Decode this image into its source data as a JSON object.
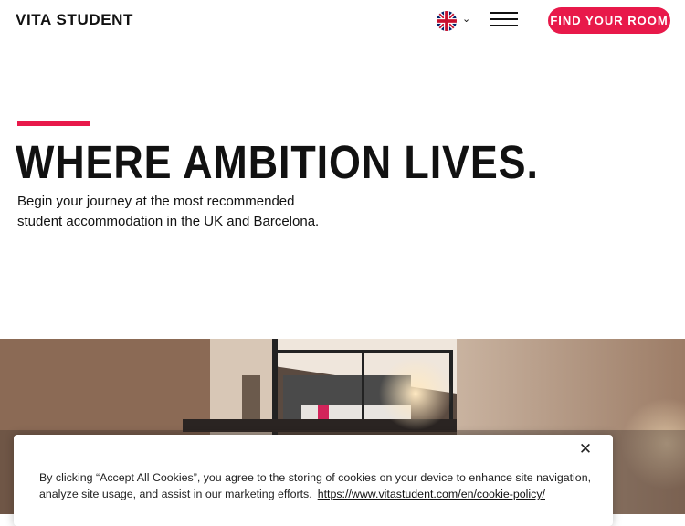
{
  "header": {
    "logo": "VITA STUDENT",
    "language_icon": "uk-flag-icon",
    "chevron_glyph": "⌄",
    "menu_icon": "hamburger-icon",
    "cta_label": "FIND YOUR ROOM"
  },
  "hero": {
    "title": "WHERE AMBITION LIVES.",
    "subtitle_line1": "Begin your journey at the most recommended",
    "subtitle_line2": "student accommodation in the UK and Barcelona."
  },
  "cookie_banner": {
    "close_glyph": "✕",
    "text": "By clicking “Accept All Cookies”, you agree to the storing of cookies on your device to enhance site navigation, analyze site usage, and assist in our marketing efforts.",
    "link_text": "https://www.vitastudent.com/en/cookie-policy/"
  },
  "colors": {
    "accent": "#e8194a",
    "text": "#111111",
    "background": "#ffffff"
  }
}
